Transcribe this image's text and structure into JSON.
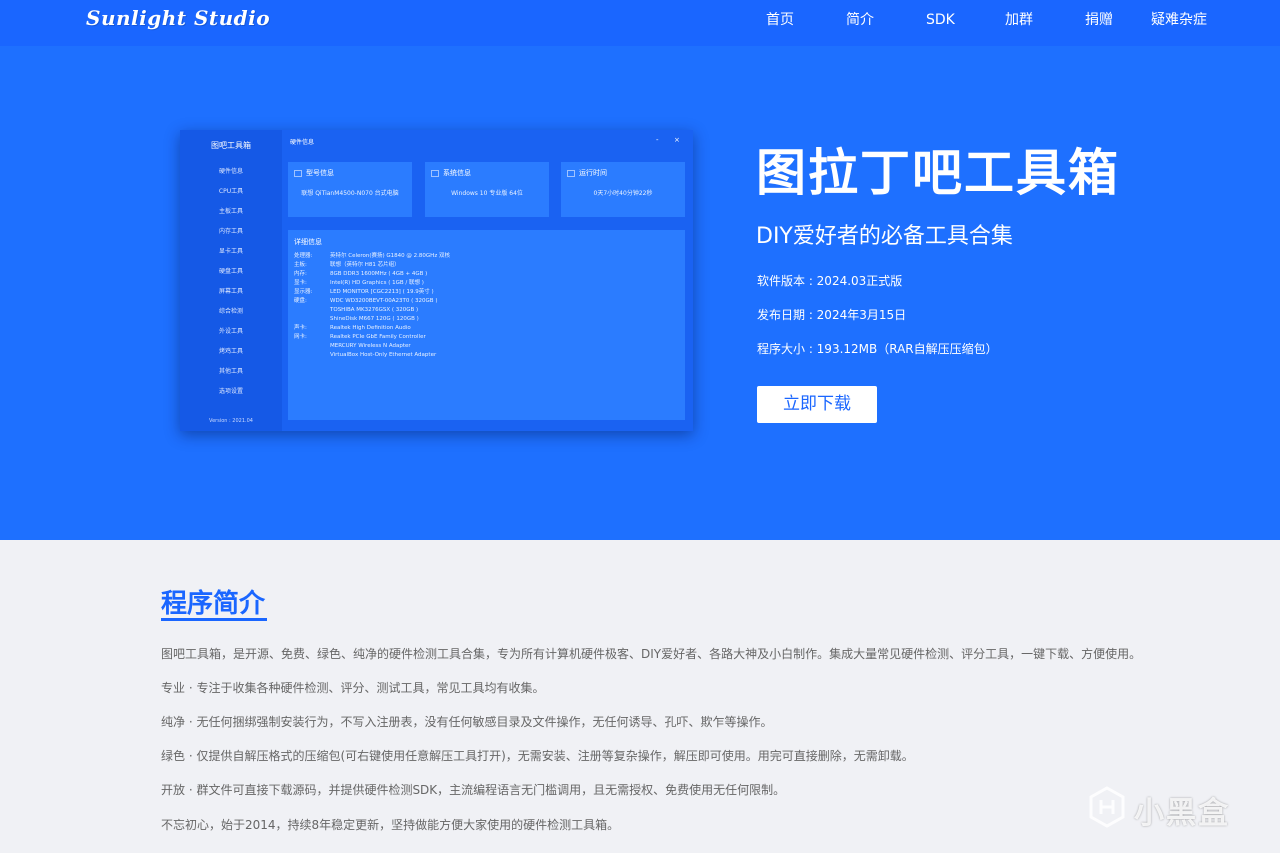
{
  "header": {
    "logo": "Sunlight Studio",
    "nav": [
      "首页",
      "简介",
      "SDK",
      "加群",
      "捐赠",
      "疑难杂症"
    ]
  },
  "mock_app": {
    "side_title": "图吧工具箱",
    "side_items": [
      "硬件信息",
      "CPU工具",
      "主板工具",
      "内存工具",
      "显卡工具",
      "硬盘工具",
      "屏幕工具",
      "综合检测",
      "外设工具",
      "烤鸡工具",
      "其他工具",
      "选项设置"
    ],
    "version": "Version : 2021.04",
    "window_title": "硬件信息",
    "window_min": "-",
    "window_close": "×",
    "cards": [
      {
        "title": "型号信息",
        "value": "联想 QiTianM4500-N070 台式电脑"
      },
      {
        "title": "系统信息",
        "value": "Windows 10 专业版 64位"
      },
      {
        "title": "运行时间",
        "value": "0天7小时40分钟22秒"
      }
    ],
    "detail_title": "详细信息",
    "details": [
      {
        "k": "处理器:",
        "v": "英特尔 Celeron(赛扬) G1840 @ 2.80GHz 双核"
      },
      {
        "k": "主板:",
        "v": "联想（英特尔 H81 芯片组）"
      },
      {
        "k": "内存:",
        "v": "8GB DDR3 1600MHz ( 4GB + 4GB )"
      },
      {
        "k": "显卡:",
        "v": "Intel(R) HD Graphics ( 1GB / 联想 )"
      },
      {
        "k": "显示器:",
        "v": "LED MONITOR [CGC2213] ( 19.9英寸 )"
      },
      {
        "k": "硬盘:",
        "v": "WDC WD3200BEVT-00A23T0 ( 320GB )"
      },
      {
        "k": "",
        "v": "TOSHIBA MK3276GSX ( 320GB )"
      },
      {
        "k": "",
        "v": "ShineDisk M667 120G ( 120GB )"
      },
      {
        "k": "声卡:",
        "v": "Realtek High Definition Audio"
      },
      {
        "k": "网卡:",
        "v": "Realtek PCIe GbE Family Controller"
      },
      {
        "k": "",
        "v": "MERCURY Wireless N Adapter"
      },
      {
        "k": "",
        "v": "VirtualBox Host-Only Ethernet Adapter"
      }
    ]
  },
  "hero": {
    "title": "图拉丁吧工具箱",
    "subtitle": "DIY爱好者的必备工具合集",
    "version": "软件版本 : 2024.03正式版",
    "date": "发布日期 : 2024年3月15日",
    "size": "程序大小 : 193.12MB（RAR自解压压缩包）",
    "download": "立即下载"
  },
  "intro": {
    "title": "程序简介",
    "paragraphs": [
      "图吧工具箱，是开源、免费、绿色、纯净的硬件检测工具合集，专为所有计算机硬件极客、DIY爱好者、各路大神及小白制作。集成大量常见硬件检测、评分工具，一键下载、方便使用。",
      "专业 · 专注于收集各种硬件检测、评分、测试工具，常见工具均有收集。",
      "纯净 · 无任何捆绑强制安装行为，不写入注册表，没有任何敏感目录及文件操作，无任何诱导、孔吓、欺乍等操作。",
      "绿色 · 仅提供自解压格式的压缩包(可右键使用任意解压工具打开)，无需安装、注册等复杂操作，解压即可使用。用完可直接删除，无需卸载。",
      "开放 · 群文件可直接下载源码，并提供硬件检测SDK，主流编程语言无门槛调用，且无需授权、免费使用无任何限制。",
      "不忘初心，始于2014，持续8年稳定更新，坚持做能方便大家使用的硬件检测工具箱。"
    ]
  },
  "watermark": {
    "text": "小黑盒"
  }
}
